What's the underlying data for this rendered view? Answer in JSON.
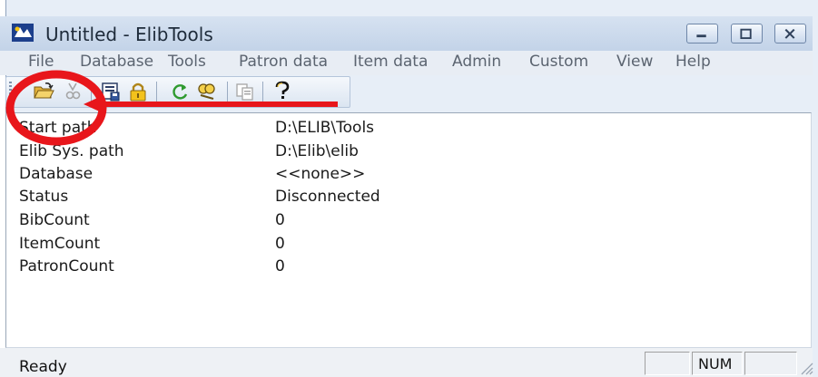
{
  "window": {
    "title": "Untitled - ElibTools",
    "controls": {
      "minimize": "minimize",
      "maximize": "maximize",
      "close": "close"
    }
  },
  "menu": [
    "File",
    "Database",
    "Tools",
    "Patron data",
    "Item data",
    "Admin",
    "Custom",
    "View",
    "Help"
  ],
  "toolbar": {
    "buttons": [
      "open-folder",
      "disconnect",
      "save-report",
      "lock",
      "refresh",
      "search",
      "copy",
      "help"
    ]
  },
  "info": {
    "rows": [
      {
        "label": "Start path",
        "value": "D:\\ELIB\\Tools"
      },
      {
        "label": "Elib Sys. path",
        "value": "D:\\Elib\\elib"
      },
      {
        "label": "Database",
        "value": "<<none>>"
      },
      {
        "label": "Status",
        "value": "Disconnected"
      },
      {
        "label": "BibCount",
        "value": "0"
      },
      {
        "label": "ItemCount",
        "value": "0"
      },
      {
        "label": "PatronCount",
        "value": "0"
      }
    ]
  },
  "statusbar": {
    "text": "Ready",
    "panels": [
      "",
      "NUM",
      ""
    ]
  },
  "annotation": {
    "color": "#e8161b"
  }
}
